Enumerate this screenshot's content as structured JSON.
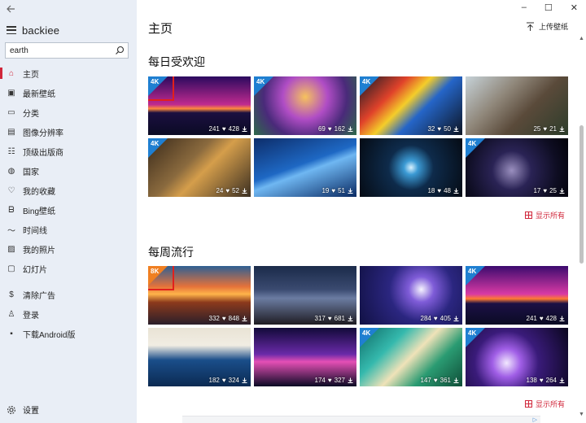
{
  "app": {
    "name": "backiee"
  },
  "search": {
    "value": "earth"
  },
  "nav": [
    {
      "label": "主页",
      "icon": "home-icon",
      "active": true
    },
    {
      "label": "最新壁纸",
      "icon": "image-icon"
    },
    {
      "label": "分类",
      "icon": "folder-icon"
    },
    {
      "label": "图像分辨率",
      "icon": "monitor-icon"
    },
    {
      "label": "顶级出版商",
      "icon": "publisher-icon"
    },
    {
      "label": "国家",
      "icon": "globe-icon"
    },
    {
      "label": "我的收藏",
      "icon": "heart-icon"
    },
    {
      "label": "Bing壁纸",
      "icon": "bing-icon"
    },
    {
      "label": "时间线",
      "icon": "timeline-icon"
    },
    {
      "label": "我的照片",
      "icon": "photos-icon"
    },
    {
      "label": "幻灯片",
      "icon": "slideshow-icon"
    },
    {
      "label": "清除广告",
      "icon": "dollar-icon"
    },
    {
      "label": "登录",
      "icon": "user-icon"
    },
    {
      "label": "下载Android版",
      "icon": "android-icon"
    }
  ],
  "settings": {
    "label": "设置"
  },
  "header": {
    "title": "主页",
    "upload_label": "上传壁纸"
  },
  "daily": {
    "title": "每日受欢迎",
    "show_all": "显示所有",
    "tiles": [
      {
        "badge": "4K",
        "likes": "241",
        "downloads": "428",
        "art": "t-synth",
        "highlight": true
      },
      {
        "badge": "4K",
        "likes": "69",
        "downloads": "162",
        "art": "t-castle"
      },
      {
        "badge": "4K",
        "likes": "32",
        "downloads": "50",
        "art": "t-times"
      },
      {
        "badge": "",
        "likes": "25",
        "downloads": "21",
        "art": "t-dog"
      },
      {
        "badge": "4K",
        "likes": "24",
        "downloads": "52",
        "art": "t-car"
      },
      {
        "badge": "",
        "likes": "19",
        "downloads": "51",
        "art": "t-blue"
      },
      {
        "badge": "",
        "likes": "18",
        "downloads": "48",
        "art": "t-abs"
      },
      {
        "badge": "4K",
        "likes": "17",
        "downloads": "25",
        "art": "t-planet"
      }
    ]
  },
  "weekly": {
    "title": "每周流行",
    "show_all": "显示所有",
    "tiles": [
      {
        "badge": "8K",
        "badge_color": "#f07f21",
        "likes": "332",
        "downloads": "848",
        "art": "t-sunset",
        "highlight": true
      },
      {
        "badge": "",
        "likes": "317",
        "downloads": "681",
        "art": "t-lambo"
      },
      {
        "badge": "",
        "likes": "284",
        "downloads": "405",
        "art": "t-moon"
      },
      {
        "badge": "4K",
        "likes": "241",
        "downloads": "428",
        "art": "t-synth2"
      },
      {
        "badge": "",
        "likes": "182",
        "downloads": "324",
        "art": "t-wave"
      },
      {
        "badge": "",
        "likes": "174",
        "downloads": "327",
        "art": "t-city"
      },
      {
        "badge": "4K",
        "likes": "147",
        "downloads": "361",
        "art": "t-beach"
      },
      {
        "badge": "4K",
        "likes": "138",
        "downloads": "264",
        "art": "t-orb"
      }
    ]
  },
  "colors": {
    "accent": "#d0263a",
    "badge_4k": "#1f7fd1",
    "badge_8k": "#f07f21",
    "highlight_box": "#e2201b",
    "sidebar_bg": "#e9eef6"
  }
}
